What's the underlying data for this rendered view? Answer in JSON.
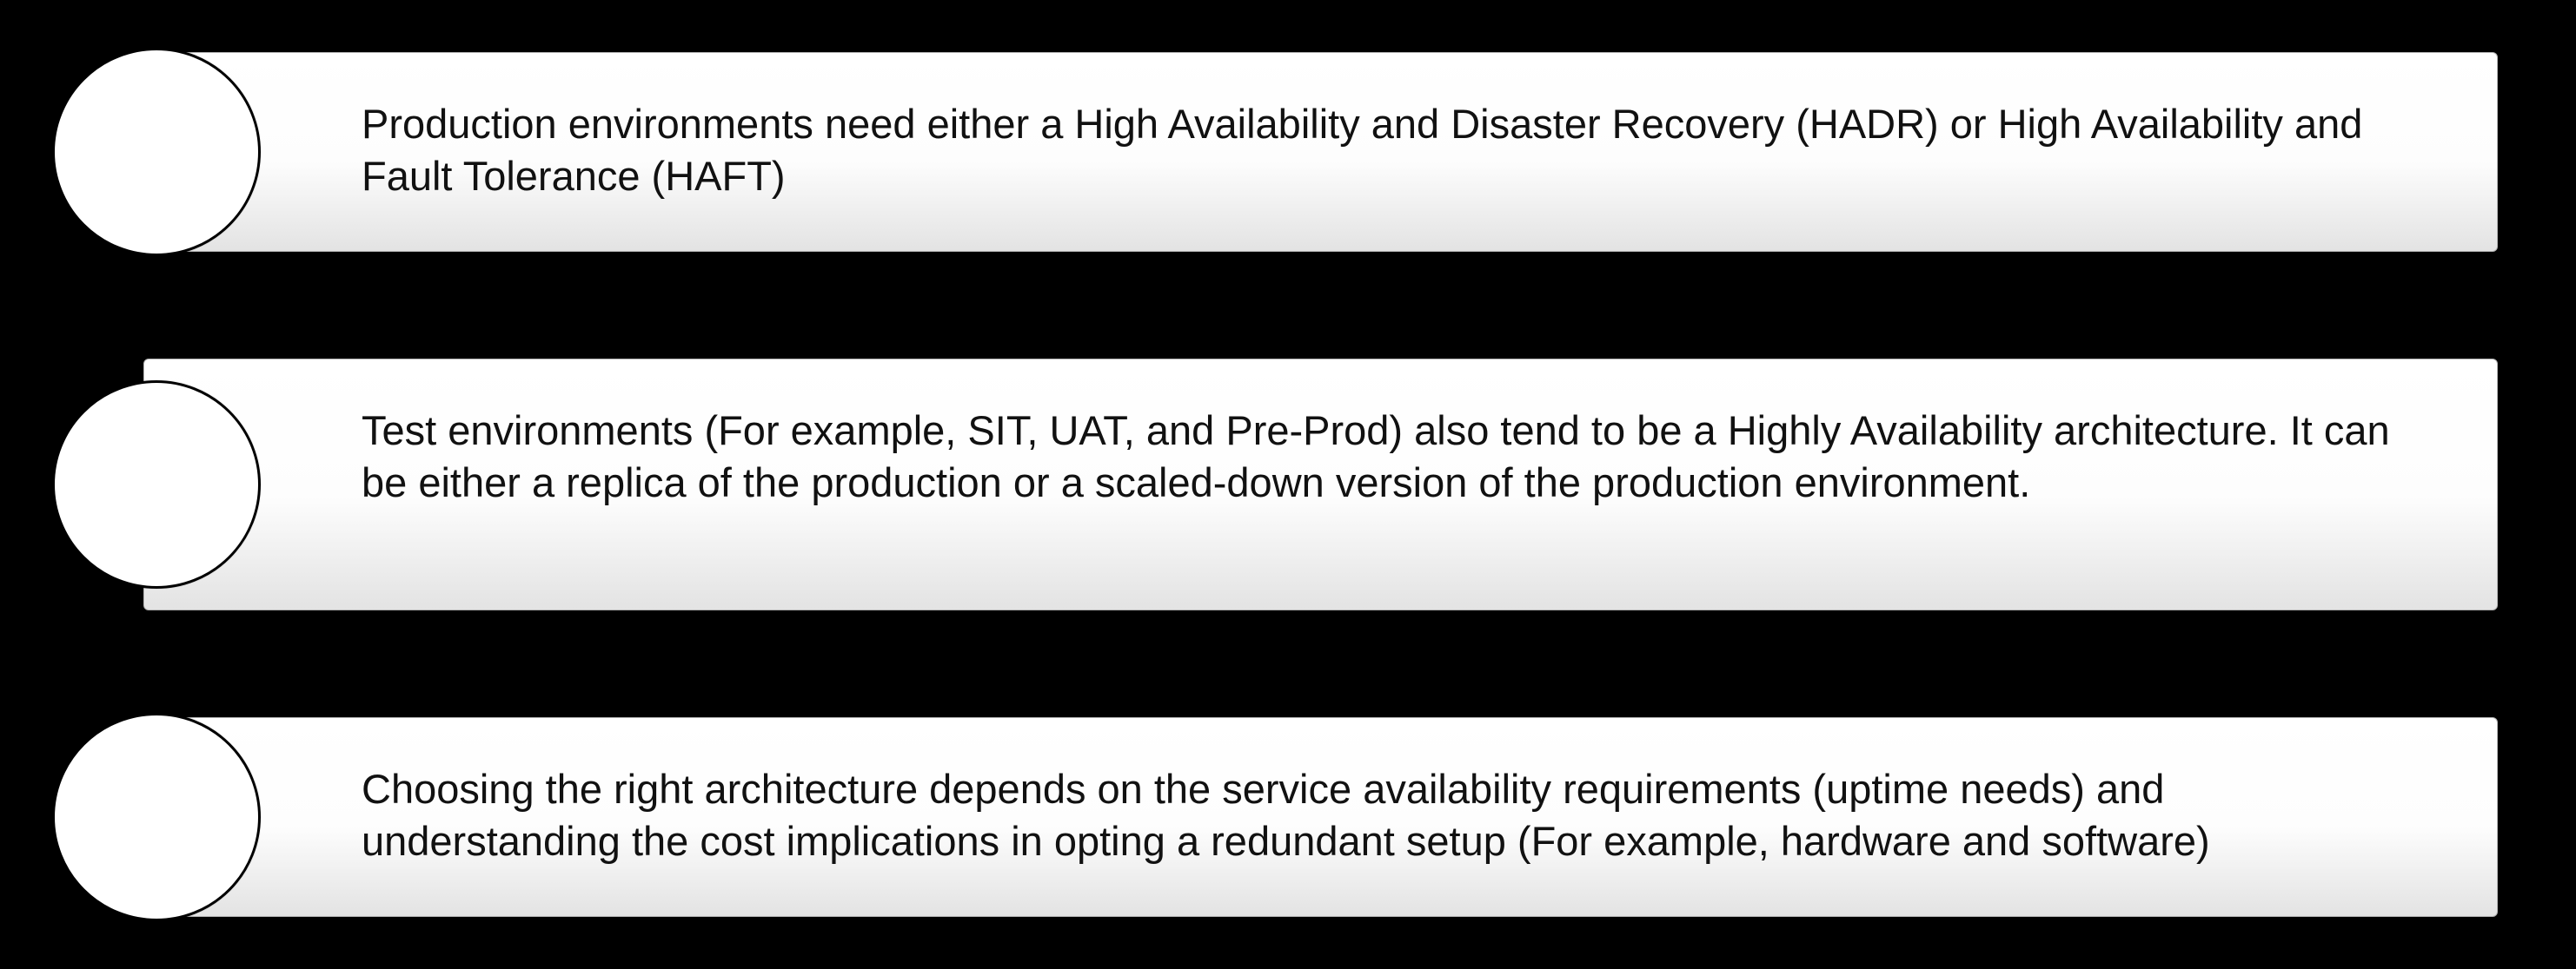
{
  "items": [
    {
      "text": "Production environments need either a High Availability and Disaster Recovery (HADR) or High Availability and Fault Tolerance (HAFT)"
    },
    {
      "text": "Test environments (For example, SIT, UAT, and Pre-Prod) also tend to be a Highly Availability architecture. It can be either a replica of the production or a scaled-down version of the production environment."
    },
    {
      "text": "Choosing the right architecture depends on the service availability requirements (uptime needs) and understanding the cost implications in opting a redundant setup (For example, hardware and software)"
    }
  ]
}
